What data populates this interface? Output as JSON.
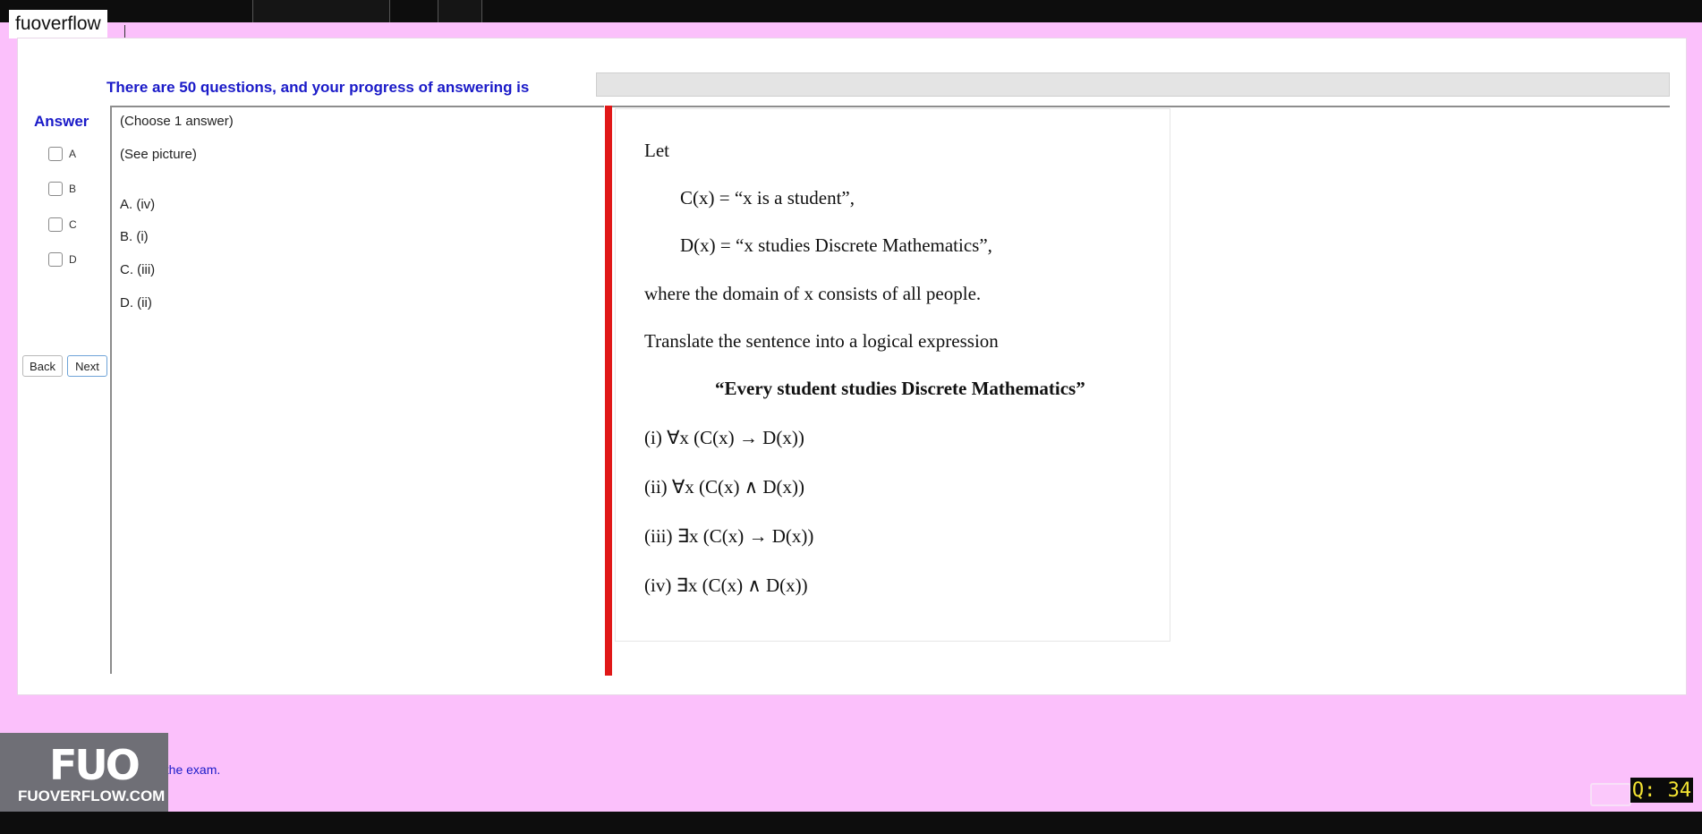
{
  "watermark": {
    "text": "fuoverflow"
  },
  "progress": {
    "label": "There are 50 questions, and your progress of answering is",
    "fraction": 0
  },
  "answer_panel": {
    "title": "Answer",
    "options": [
      "A",
      "B",
      "C",
      "D"
    ],
    "back_label": "Back",
    "next_label": "Next"
  },
  "question": {
    "instruction": "(Choose 1 answer)",
    "hint": "(See picture)",
    "choices": [
      "A.  (iv)",
      "B.  (i)",
      "C.  (iii)",
      "D.  (ii)"
    ]
  },
  "picture": {
    "lines": [
      "Let",
      "C(x) =  “x is a student”,",
      "D(x) =  “x studies Discrete Mathematics”,",
      "where the domain of x consists of all people.",
      "Translate the sentence into a logical expression",
      "“Every student studies Discrete Mathematics”",
      "(i)    ∀x (C(x) → D(x))",
      "(ii)   ∀x (C(x) ∧ D(x))",
      "(iii)  ∃x (C(x) → D(x))",
      "(iv)  ∃x (C(x) ∧ D(x))"
    ]
  },
  "logo": {
    "mark": "FUO",
    "url": "FUOVERFLOW.COM"
  },
  "finish": {
    "label": "ish the exam."
  },
  "counter": {
    "text": "Q: 34"
  },
  "colors": {
    "background": "#fbc0fb",
    "accent_text": "#1a1ac8",
    "divider": "#e01818",
    "counter_text": "#f3e332"
  }
}
